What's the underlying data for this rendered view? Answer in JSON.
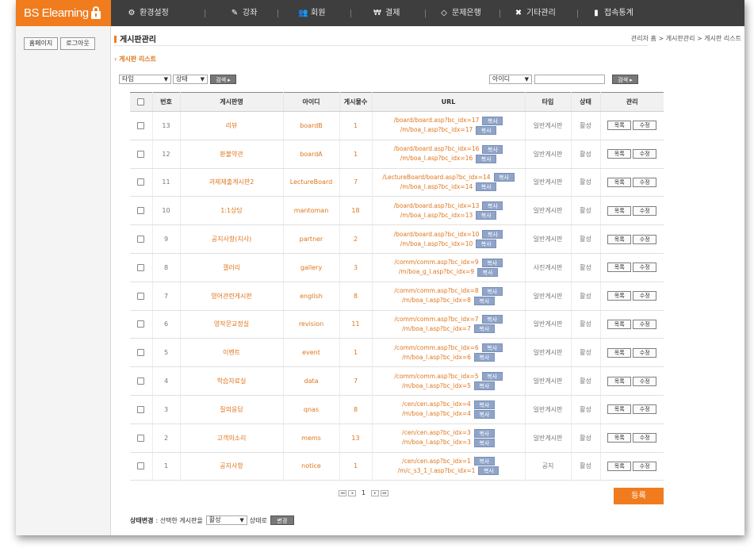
{
  "brand": {
    "name": "BS Elearning"
  },
  "nav": [
    {
      "icon": "gear-icon",
      "glyph": "⚙",
      "label": "환경설정"
    },
    {
      "icon": "pencil-icon",
      "glyph": "✎",
      "label": "강좌"
    },
    {
      "icon": "users-icon",
      "glyph": "👥",
      "label": "회원"
    },
    {
      "icon": "payment-icon",
      "glyph": "₩",
      "label": "결제"
    },
    {
      "icon": "question-bank-icon",
      "glyph": "◇",
      "label": "문제은행"
    },
    {
      "icon": "tools-icon",
      "glyph": "✖",
      "label": "기타관리"
    },
    {
      "icon": "stats-icon",
      "glyph": "▮",
      "label": "접속통계"
    }
  ],
  "sidebar": {
    "homepage": "홈페이지",
    "logout": "로그아웃"
  },
  "page": {
    "title": "게시판관리",
    "breadcrumb": "관리자 홈 > 게시판관리 > 게시판 리스트",
    "section": "› 게시판 리스트"
  },
  "filters": {
    "type_select": "타입",
    "status_select": "상태",
    "search_button": "검색 ▸",
    "field_select": "아이디",
    "search_value": "",
    "search_button_right": "검색 ▸"
  },
  "table": {
    "headers": [
      "",
      "번호",
      "게시판명",
      "아이디",
      "게시물수",
      "URL",
      "타입",
      "상태",
      "관리"
    ],
    "copy_label": "복사",
    "list_label": "목록",
    "edit_label": "수정",
    "rows": [
      {
        "no": "13",
        "name": "리뷰",
        "id": "boardB",
        "count": "1",
        "url1": "/board/board.asp?bc_idx=17",
        "url2": "/m/boa_l.asp?bc_idx=17",
        "type": "일반게시판",
        "status": "활성"
      },
      {
        "no": "12",
        "name": "환불약관",
        "id": "boardA",
        "count": "1",
        "url1": "/board/board.asp?bc_idx=16",
        "url2": "/m/boa_l.asp?bc_idx=16",
        "type": "일반게시판",
        "status": "활성"
      },
      {
        "no": "11",
        "name": "과제제출게시판2",
        "id": "LectureBoard",
        "count": "7",
        "url1": "/LectureBoard/board.asp?bc_idx=14",
        "url2": "/m/boa_l.asp?bc_idx=14",
        "type": "일반게시판",
        "status": "활성"
      },
      {
        "no": "10",
        "name": "1:1상담",
        "id": "mantoman",
        "count": "18",
        "url1": "/board/board.asp?bc_idx=13",
        "url2": "/m/boa_l.asp?bc_idx=13",
        "type": "일반게시판",
        "status": "활성"
      },
      {
        "no": "9",
        "name": "공지사항(지사)",
        "id": "partner",
        "count": "2",
        "url1": "/board/board.asp?bc_idx=10",
        "url2": "/m/boa_l.asp?bc_idx=10",
        "type": "일반게시판",
        "status": "활성"
      },
      {
        "no": "8",
        "name": "갤러리",
        "id": "gallery",
        "count": "3",
        "url1": "/comm/comm.asp?bc_idx=9",
        "url2": "/m/boa_g_l.asp?bc_idx=9",
        "type": "사진게시판",
        "status": "활성"
      },
      {
        "no": "7",
        "name": "영어관련게시판",
        "id": "english",
        "count": "8",
        "url1": "/comm/comm.asp?bc_idx=8",
        "url2": "/m/boa_l.asp?bc_idx=8",
        "type": "일반게시판",
        "status": "활성"
      },
      {
        "no": "6",
        "name": "영작문교정실",
        "id": "revision",
        "count": "11",
        "url1": "/comm/comm.asp?bc_idx=7",
        "url2": "/m/boa_l.asp?bc_idx=7",
        "type": "일반게시판",
        "status": "활성"
      },
      {
        "no": "5",
        "name": "이벤트",
        "id": "event",
        "count": "1",
        "url1": "/comm/comm.asp?bc_idx=6",
        "url2": "/m/boa_l.asp?bc_idx=6",
        "type": "일반게시판",
        "status": "활성"
      },
      {
        "no": "4",
        "name": "학습자료실",
        "id": "data",
        "count": "7",
        "url1": "/comm/comm.asp?bc_idx=5",
        "url2": "/m/boa_l.asp?bc_idx=5",
        "type": "일반게시판",
        "status": "활성"
      },
      {
        "no": "3",
        "name": "질의응답",
        "id": "qnas",
        "count": "8",
        "url1": "/cen/cen.asp?bc_idx=4",
        "url2": "/m/boa_l.asp?bc_idx=4",
        "type": "일반게시판",
        "status": "활성"
      },
      {
        "no": "2",
        "name": "고객의소리",
        "id": "mems",
        "count": "13",
        "url1": "/cen/cen.asp?bc_idx=3",
        "url2": "/m/boa_l.asp?bc_idx=3",
        "type": "일반게시판",
        "status": "활성"
      },
      {
        "no": "1",
        "name": "공지사항",
        "id": "notice",
        "count": "1",
        "url1": "/cen/cen.asp?bc_idx=1",
        "url2": "/m/c_s3_1_l.asp?bc_idx=1",
        "type": "공지",
        "status": "활성"
      }
    ]
  },
  "pager": {
    "first": "◂◂",
    "prev": "◂",
    "current": "1",
    "next": "▸",
    "last": "▸▸"
  },
  "register_button": "등록",
  "status_change": {
    "label": "상태변경",
    "prefix": ": 선택한 게시판을",
    "selected": "활성",
    "suffix": "상태로",
    "button": "변경"
  },
  "colors": {
    "accent": "#f07c1e",
    "topbar": "#3e3e3e",
    "copy_button": "#8fa4c8"
  }
}
